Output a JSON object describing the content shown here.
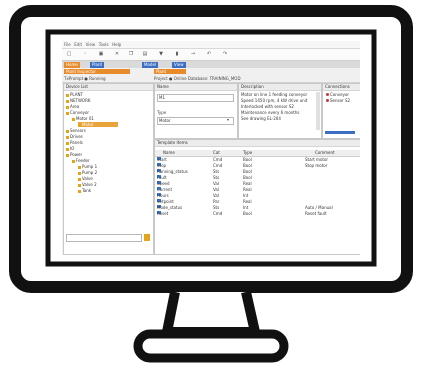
{
  "app": {
    "menu": [
      "File",
      "Edit",
      "View",
      "Tools",
      "Help"
    ],
    "tabs": [
      {
        "label": "Home"
      },
      {
        "label": "Plant"
      },
      {
        "label": "Model"
      },
      {
        "label": "View"
      }
    ],
    "context_title": "Plant Inspector",
    "context_left": "TxPrompt  ●  Running",
    "context_right": "Project  ●  Online   Database: TRAINING_MOD"
  },
  "colors": {
    "accent": "#e88b2a",
    "selection": "#e9a33b",
    "tab_blue": "#3c6fc4",
    "folder": "#e5a31a"
  },
  "tree": {
    "header": "Device List",
    "items": [
      {
        "label": "PLANT"
      },
      {
        "label": "NETWORK"
      },
      {
        "label": "Area"
      },
      {
        "label": "Conveyor"
      },
      {
        "label": "Motor 01"
      },
      {
        "label": "Motor"
      },
      {
        "label": "Sensors"
      },
      {
        "label": "Drives"
      },
      {
        "label": "Panels"
      },
      {
        "label": "IO"
      },
      {
        "label": "Power"
      },
      {
        "label": "Feeder"
      },
      {
        "label": "Pump 1"
      },
      {
        "label": "Pump 2"
      },
      {
        "label": "Valve"
      },
      {
        "label": "Valve 2"
      },
      {
        "label": "Tank"
      }
    ]
  },
  "form": {
    "name_label": "Name",
    "name_value": "M1",
    "type_label": "Type",
    "type_value": "Motor"
  },
  "description": {
    "header": "Description",
    "lines": [
      "Motor on line 1 feeding conveyor",
      "Speed 1450 rpm, 4 kW drive unit",
      "Interlocked with sensor S2",
      "Maintenance every 6 months",
      "See drawing EL-204"
    ]
  },
  "right": {
    "header": "Connections",
    "items": [
      "Conveyor",
      "Sensor S2"
    ]
  },
  "table": {
    "header": "Template Items",
    "columns": [
      "Name",
      "Cat",
      "Type",
      "Comment"
    ],
    "rows": [
      [
        "Start",
        "Cmd",
        "Bool",
        "Start motor"
      ],
      [
        "Stop",
        "Cmd",
        "Bool",
        "Stop motor"
      ],
      [
        "Running_status",
        "Sts",
        "Bool",
        ""
      ],
      [
        "Fault",
        "Sts",
        "Bool",
        ""
      ],
      [
        "Speed",
        "Val",
        "Real",
        ""
      ],
      [
        "Current",
        "Val",
        "Real",
        ""
      ],
      [
        "Hours",
        "Val",
        "Int",
        ""
      ],
      [
        "Setpoint",
        "Par",
        "Real",
        ""
      ],
      [
        "Mode_status",
        "Sts",
        "Int",
        "Auto / Manual"
      ],
      [
        "Reset",
        "Cmd",
        "Bool",
        "Reset fault"
      ]
    ]
  }
}
